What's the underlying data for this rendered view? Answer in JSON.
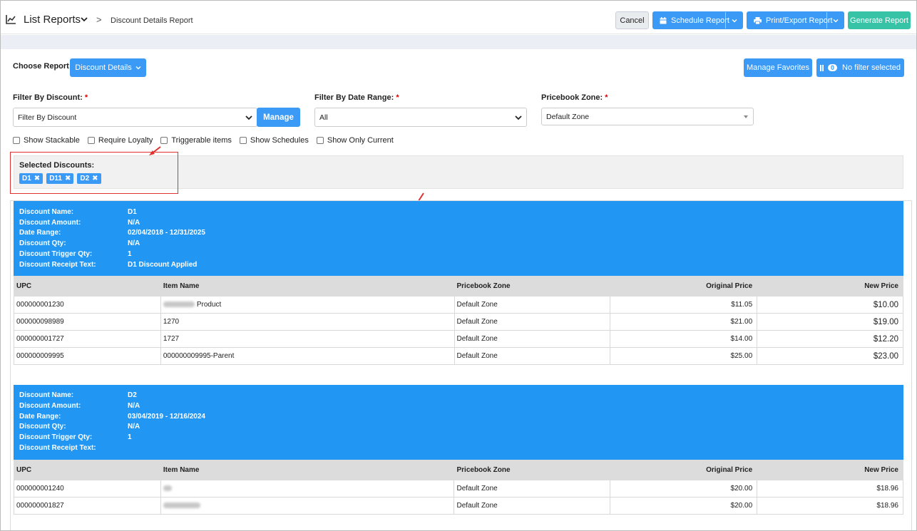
{
  "header": {
    "title": "List Reports",
    "separator": ">",
    "breadcrumb": "Discount Details Report",
    "buttons": {
      "cancel": "Cancel",
      "schedule": "Schedule Report",
      "print_export": "Print/Export Report",
      "generate": "Generate Report"
    }
  },
  "choose": {
    "label": "Choose Report",
    "report_button": "Discount Details",
    "manage_favorites": "Manage Favorites",
    "filter_count": "0",
    "filter_status": "No filter selected"
  },
  "filters": {
    "discount_label": "Filter By Discount:",
    "discount_value": "Filter By Discount",
    "manage": "Manage",
    "date_label": "Filter By Date Range:",
    "date_value": "All",
    "zone_label": "Pricebook Zone:",
    "zone_value": "Default Zone",
    "required": "*"
  },
  "checkboxes": [
    "Show Stackable",
    "Require Loyalty",
    "Triggerable items",
    "Show Schedules",
    "Show Only Current"
  ],
  "selected": {
    "title": "Selected Discounts:",
    "chips": [
      "D1",
      "D11",
      "D2"
    ]
  },
  "columns": [
    "UPC",
    "Item Name",
    "Pricebook Zone",
    "Original Price",
    "New Price"
  ],
  "field_labels": [
    "Discount Name:",
    "Discount Amount:",
    "Date Range:",
    "Discount Qty:",
    "Discount Trigger Qty:",
    "Discount Receipt Text:"
  ],
  "discounts": [
    {
      "values": [
        "D1",
        "N/A",
        "02/04/2018 - 12/31/2025",
        "N/A",
        "1",
        "D1 Discount Applied"
      ],
      "rows": [
        {
          "upc": "000000001230",
          "item": "Product",
          "zone": "Default Zone",
          "orig": "$11.05",
          "new": "$10.00"
        },
        {
          "upc": "000000098989",
          "item": "1270",
          "zone": "Default Zone",
          "orig": "$21.00",
          "new": "$19.00"
        },
        {
          "upc": "000000001727",
          "item": "1727",
          "zone": "Default Zone",
          "orig": "$14.00",
          "new": "$12.20"
        },
        {
          "upc": "000000009995",
          "item": "000000009995-Parent",
          "zone": "Default Zone",
          "orig": "$25.00",
          "new": "$23.00"
        }
      ]
    },
    {
      "values": [
        "D2",
        "N/A",
        "03/04/2019 - 12/16/2024",
        "N/A",
        "1",
        ""
      ],
      "rows": [
        {
          "upc": "000000001240",
          "item": "",
          "zone": "Default Zone",
          "orig": "$20.00",
          "new": "$18.96"
        },
        {
          "upc": "000000001827",
          "item": "",
          "zone": "Default Zone",
          "orig": "$20.00",
          "new": "$18.96"
        }
      ]
    }
  ],
  "colors": {
    "primary": "#2196f3",
    "button": "#3a9af5",
    "generate": "#37c3a6",
    "annotation": "#e03030"
  }
}
